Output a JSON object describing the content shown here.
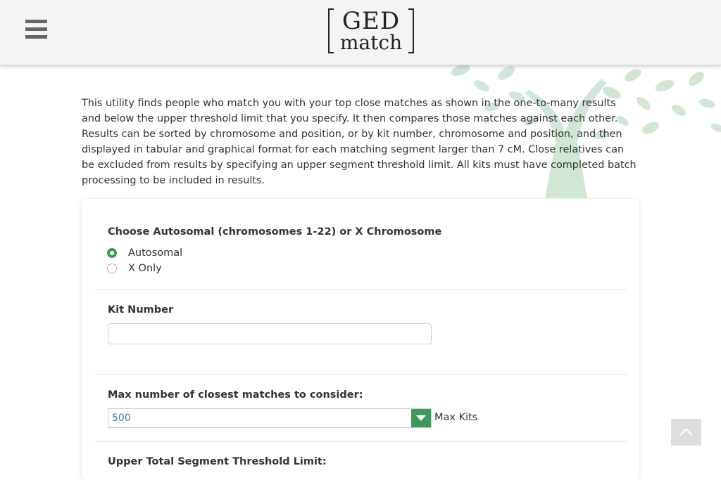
{
  "header": {
    "menu_icon": "hamburger-menu-icon",
    "logo": {
      "line1": "GED",
      "line2": "match"
    }
  },
  "intro": {
    "text": "This utility finds people who match you with your top close matches as shown in the one-to-many results and below the upper threshold limit that you specify. It then compares those matches against each other. Results can be sorted by chromosome and position, or by kit number, chromosome and position, and then displayed in tabular and graphical format for each matching segment larger than 7 cM. Close relatives can be excluded from results by specifying an upper segment threshold limit. All kits must have completed batch processing to be included in results."
  },
  "form": {
    "chromosome_label": "Choose Autosomal (chromosomes 1-22) or X Chromosome",
    "options": [
      {
        "label": "Autosomal",
        "checked": true
      },
      {
        "label": "X Only",
        "checked": false
      }
    ],
    "kit_label": "Kit Number",
    "kit_value": "",
    "max_label": "Max number of closest matches to consider:",
    "max_value": "500",
    "max_suffix": "Max Kits",
    "threshold_label": "Upper Total Segment Threshold Limit:"
  },
  "colors": {
    "accent_green": "#3e9a5a",
    "select_text_blue": "#2d7fbf",
    "tree_green": "#c9e3cf"
  },
  "scroll_top_icon": "chevron-up-icon"
}
